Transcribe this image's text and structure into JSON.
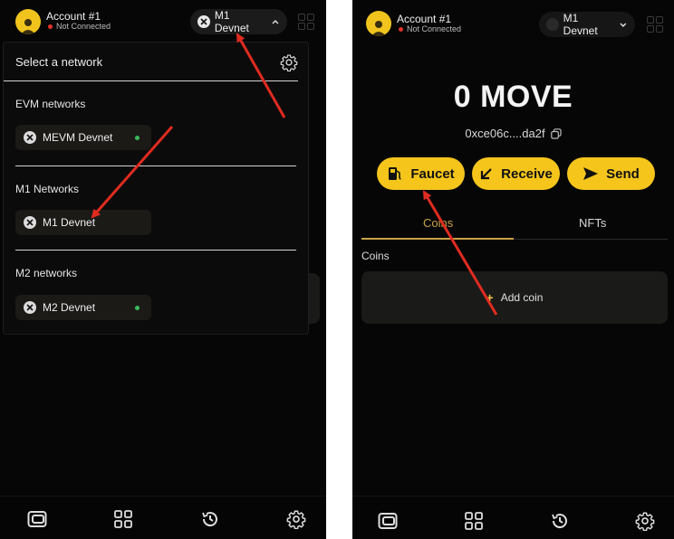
{
  "left_screen": {
    "account": {
      "name": "Account #1",
      "status": "Not Connected"
    },
    "network_button": {
      "label": "M1 Devnet"
    },
    "dropdown": {
      "title": "Select a network",
      "sections": [
        {
          "label": "EVM networks",
          "network": "MEVM Devnet",
          "online": true
        },
        {
          "label": "M1 Networks",
          "network": "M1 Devnet",
          "online": false
        },
        {
          "label": "M2 networks",
          "network": "M2 Devnet",
          "online": true
        }
      ]
    }
  },
  "right_screen": {
    "account": {
      "name": "Account #1",
      "status": "Not Connected"
    },
    "network_button": {
      "label": "M1 Devnet"
    },
    "balance": "0 MOVE",
    "address": "0xce06c....da2f",
    "actions": {
      "faucet": "Faucet",
      "receive": "Receive",
      "send": "Send"
    },
    "tabs": {
      "coins": "Coins",
      "nfts": "NFTs"
    },
    "coins_label": "Coins",
    "add_coin": "Add coin"
  },
  "bottom_nav": [
    "wallet-icon",
    "apps-grid-icon",
    "history-icon",
    "settings-gear-icon"
  ],
  "colors": {
    "accent_yellow": "#f5c51c",
    "panel_bg": "#060606",
    "card_bg": "#1b1a17",
    "tab_active": "#c9a24a",
    "status_red": "#e0342c",
    "online_green": "#3bbb5a",
    "annotation_red": "#e02b20"
  }
}
